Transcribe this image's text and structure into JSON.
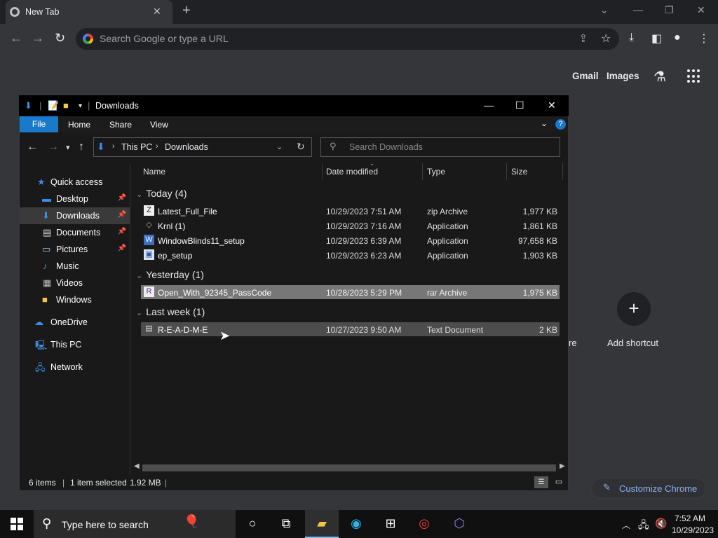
{
  "chrome": {
    "tab_title": "New Tab",
    "omnibox_placeholder": "Search Google or type a URL",
    "ntp": {
      "gmail": "Gmail",
      "images": "Images",
      "add_shortcut": "Add shortcut",
      "partial_shortcut": "re",
      "customize": "Customize Chrome"
    }
  },
  "explorer": {
    "title": "Downloads",
    "ribbon_tabs": [
      "File",
      "Home",
      "Share",
      "View"
    ],
    "breadcrumb": [
      "This PC",
      "Downloads"
    ],
    "search_placeholder": "Search Downloads",
    "nav": [
      {
        "label": "Quick access",
        "icon": "star-icon"
      },
      {
        "label": "Desktop",
        "icon": "desktop-icon",
        "pinned": true
      },
      {
        "label": "Downloads",
        "icon": "download-icon",
        "pinned": true,
        "selected": true
      },
      {
        "label": "Documents",
        "icon": "documents-icon",
        "pinned": true
      },
      {
        "label": "Pictures",
        "icon": "pictures-icon",
        "pinned": true
      },
      {
        "label": "Music",
        "icon": "music-icon"
      },
      {
        "label": "Videos",
        "icon": "videos-icon"
      },
      {
        "label": "Windows",
        "icon": "folder-icon"
      },
      {
        "label": "OneDrive",
        "icon": "cloud-icon"
      },
      {
        "label": "This PC",
        "icon": "computer-icon"
      },
      {
        "label": "Network",
        "icon": "network-icon"
      }
    ],
    "columns": [
      "Name",
      "Date modified",
      "Type",
      "Size"
    ],
    "groups": [
      {
        "label": "Today (4)",
        "files": [
          {
            "name": "Latest_Full_File",
            "date": "10/29/2023 7:51 AM",
            "type": "zip Archive",
            "size": "1,977 KB"
          },
          {
            "name": "Krnl (1)",
            "date": "10/29/2023 7:16 AM",
            "type": "Application",
            "size": "1,861 KB"
          },
          {
            "name": "WindowBlinds11_setup",
            "date": "10/29/2023 6:39 AM",
            "type": "Application",
            "size": "97,658 KB"
          },
          {
            "name": "ep_setup",
            "date": "10/29/2023 6:23 AM",
            "type": "Application",
            "size": "1,903 KB"
          }
        ]
      },
      {
        "label": "Yesterday (1)",
        "files": [
          {
            "name": "Open_With_92345_PassCode",
            "date": "10/28/2023 5:29 PM",
            "type": "rar Archive",
            "size": "1,975 KB"
          }
        ]
      },
      {
        "label": "Last week (1)",
        "files": [
          {
            "name": "R-E-A-D-M-E",
            "date": "10/27/2023 9:50 AM",
            "type": "Text Document",
            "size": "2 KB"
          }
        ]
      }
    ],
    "status": {
      "items": "6 items",
      "selected": "1 item selected",
      "size": "1.92 MB"
    }
  },
  "taskbar": {
    "search_placeholder": "Type here to search",
    "time": "7:52 AM",
    "date": "10/29/2023"
  }
}
